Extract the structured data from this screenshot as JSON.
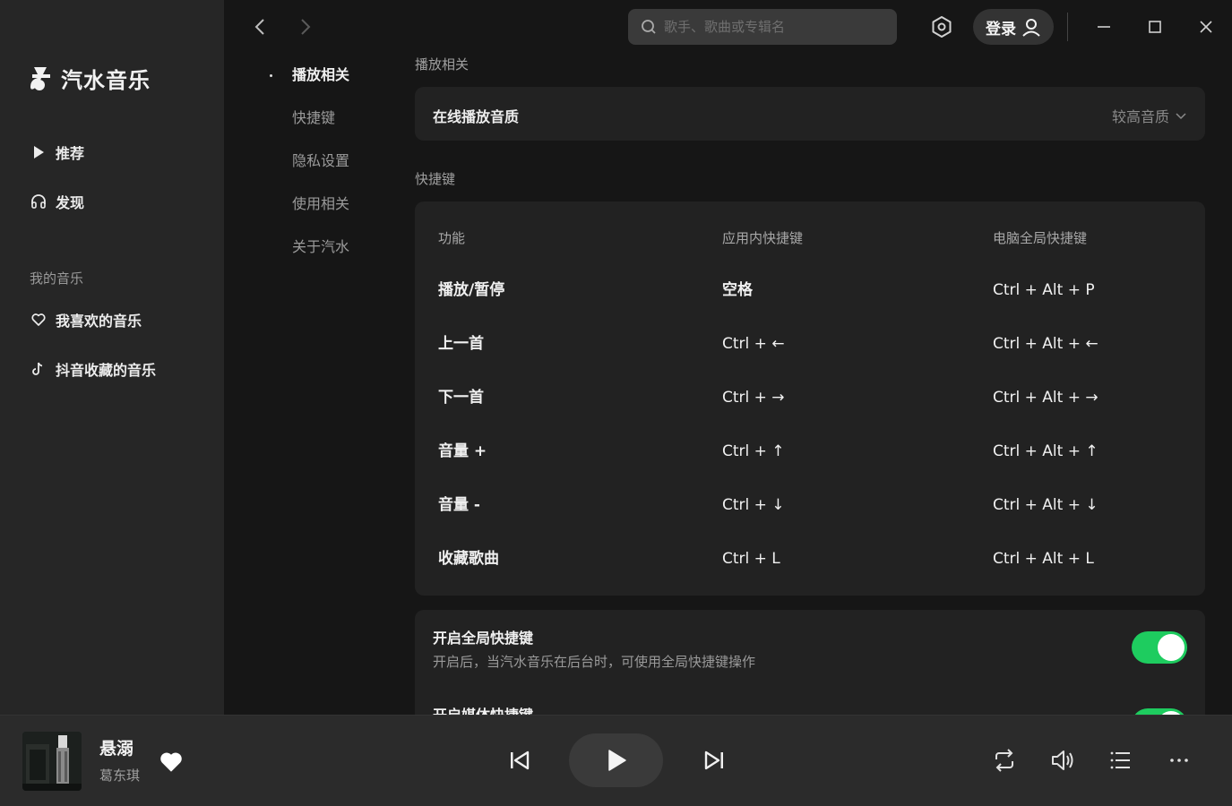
{
  "app": {
    "name": "汽水音乐"
  },
  "sidebar": {
    "nav": [
      {
        "label": "推荐",
        "icon": "play-icon"
      },
      {
        "label": "发现",
        "icon": "headphones-icon"
      }
    ],
    "section_title": "我的音乐",
    "my_music": [
      {
        "label": "我喜欢的音乐",
        "icon": "heart-outline-icon"
      },
      {
        "label": "抖音收藏的音乐",
        "icon": "tiktok-icon"
      }
    ]
  },
  "subnav": {
    "items": [
      {
        "label": "播放相关",
        "active": true
      },
      {
        "label": "快捷键",
        "active": false
      },
      {
        "label": "隐私设置",
        "active": false
      },
      {
        "label": "使用相关",
        "active": false
      },
      {
        "label": "关于汽水",
        "active": false
      }
    ]
  },
  "topbar": {
    "search_placeholder": "歌手、歌曲或专辑名",
    "login_label": "登录"
  },
  "main": {
    "play_section_title": "播放相关",
    "quality_label": "在线播放音质",
    "quality_value": "较高音质",
    "shortcut_section_title": "快捷键",
    "shortcut_headers": [
      "功能",
      "应用内快捷键",
      "电脑全局快捷键"
    ],
    "shortcuts": [
      {
        "func": "播放/暂停",
        "app": "空格",
        "global": "Ctrl + Alt + P"
      },
      {
        "func": "上一首",
        "app": "Ctrl + ←",
        "global": "Ctrl + Alt + ←"
      },
      {
        "func": "下一首",
        "app": "Ctrl + →",
        "global": "Ctrl + Alt + →"
      },
      {
        "func": "音量 +",
        "app": "Ctrl + ↑",
        "global": "Ctrl + Alt + ↑"
      },
      {
        "func": "音量 -",
        "app": "Ctrl + ↓",
        "global": "Ctrl + Alt + ↓"
      },
      {
        "func": "收藏歌曲",
        "app": "Ctrl + L",
        "global": "Ctrl + Alt + L"
      }
    ],
    "global_shortcut_toggle": {
      "title": "开启全局快捷键",
      "desc": "开启后，当汽水音乐在后台时，可使用全局快捷键操作",
      "on": true
    },
    "media_shortcut_toggle": {
      "title": "开启媒体快捷键",
      "on": true
    }
  },
  "player": {
    "title": "悬溺",
    "artist": "葛东琪",
    "liked": true
  },
  "colors": {
    "accent": "#1ecc5f",
    "sidebar_bg": "#262626",
    "main_bg": "#161616",
    "card_bg": "#222222",
    "player_bg": "#2b2b2b"
  }
}
